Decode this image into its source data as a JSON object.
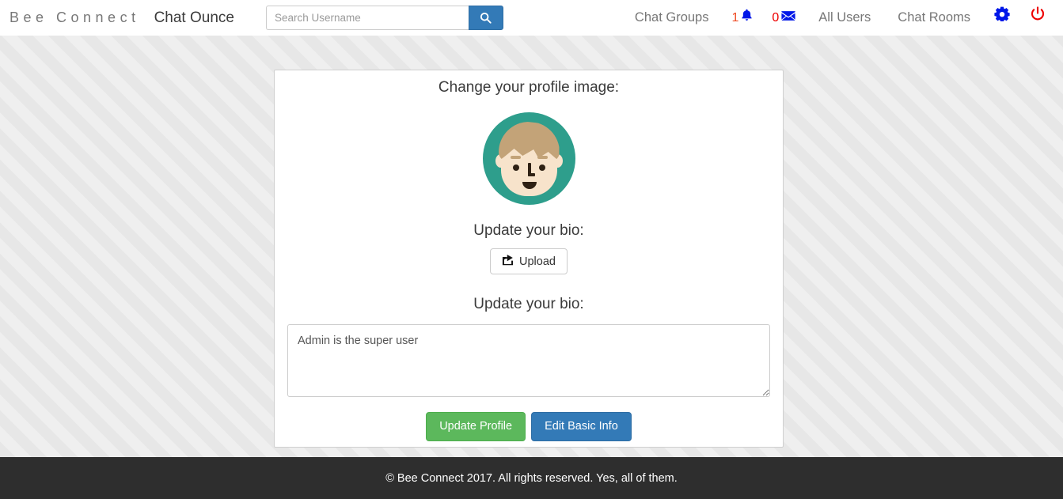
{
  "navbar": {
    "brand": "Bee Connect",
    "app_link": "Chat Ounce",
    "search": {
      "placeholder": "Search Username",
      "value": "",
      "button_icon": "search-icon"
    },
    "links": [
      {
        "label": "Chat Groups"
      },
      {
        "label": "All Users"
      },
      {
        "label": "Chat Rooms"
      }
    ],
    "notifications": {
      "count": "1",
      "icon": "bell-icon",
      "count_color": "#ef4b24",
      "icon_color": "#0017e8"
    },
    "messages": {
      "count": "0",
      "icon": "envelope-icon",
      "count_color": "#ee0000",
      "icon_color": "#0017e8"
    },
    "settings_icon": "gear-icon",
    "settings_icon_color": "#0017e8",
    "logout_icon": "power-icon",
    "logout_icon_color": "#ee0000"
  },
  "card": {
    "heading": "Change your profile image:",
    "avatar": {
      "name": "profile-avatar",
      "background_color": "#2e9e8c",
      "hair_color": "#c3a378",
      "skin_color": "#f7e3cb",
      "feature_color": "#2f2114"
    },
    "bio_label_1": "Update your bio:",
    "upload_button": {
      "label": "Upload",
      "icon": "share-square-icon"
    },
    "bio_label_2": "Update your bio:",
    "bio_textarea": {
      "value": "Admin is the super user",
      "placeholder": ""
    },
    "buttons": {
      "update_profile": "Update Profile",
      "update_profile_color": "#5cb85c",
      "edit_basic_info": "Edit Basic Info",
      "edit_basic_info_color": "#337ab7"
    }
  },
  "footer": {
    "text": "© Bee Connect 2017. All rights reserved. Yes, all of them."
  }
}
